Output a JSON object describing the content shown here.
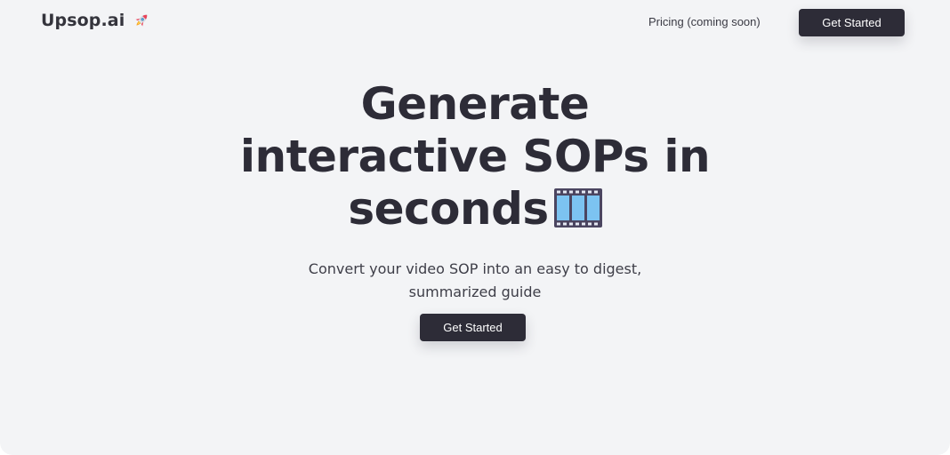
{
  "header": {
    "logo_text": "Upsop.ai",
    "logo_icon": "rocket-icon",
    "nav_link": "Pricing (coming soon)",
    "cta_label": "Get Started"
  },
  "hero": {
    "title_line1": "Generate",
    "title_line2": "interactive SOPs in",
    "title_line3": "seconds",
    "title_icon": "film-frames-icon",
    "subtitle_line1": "Convert your video SOP into an easy to digest,",
    "subtitle_line2": "summarized guide",
    "cta_label": "Get Started"
  },
  "colors": {
    "background": "#f3f4f6",
    "button": "#2d2c37",
    "text": "#2d2c37"
  }
}
